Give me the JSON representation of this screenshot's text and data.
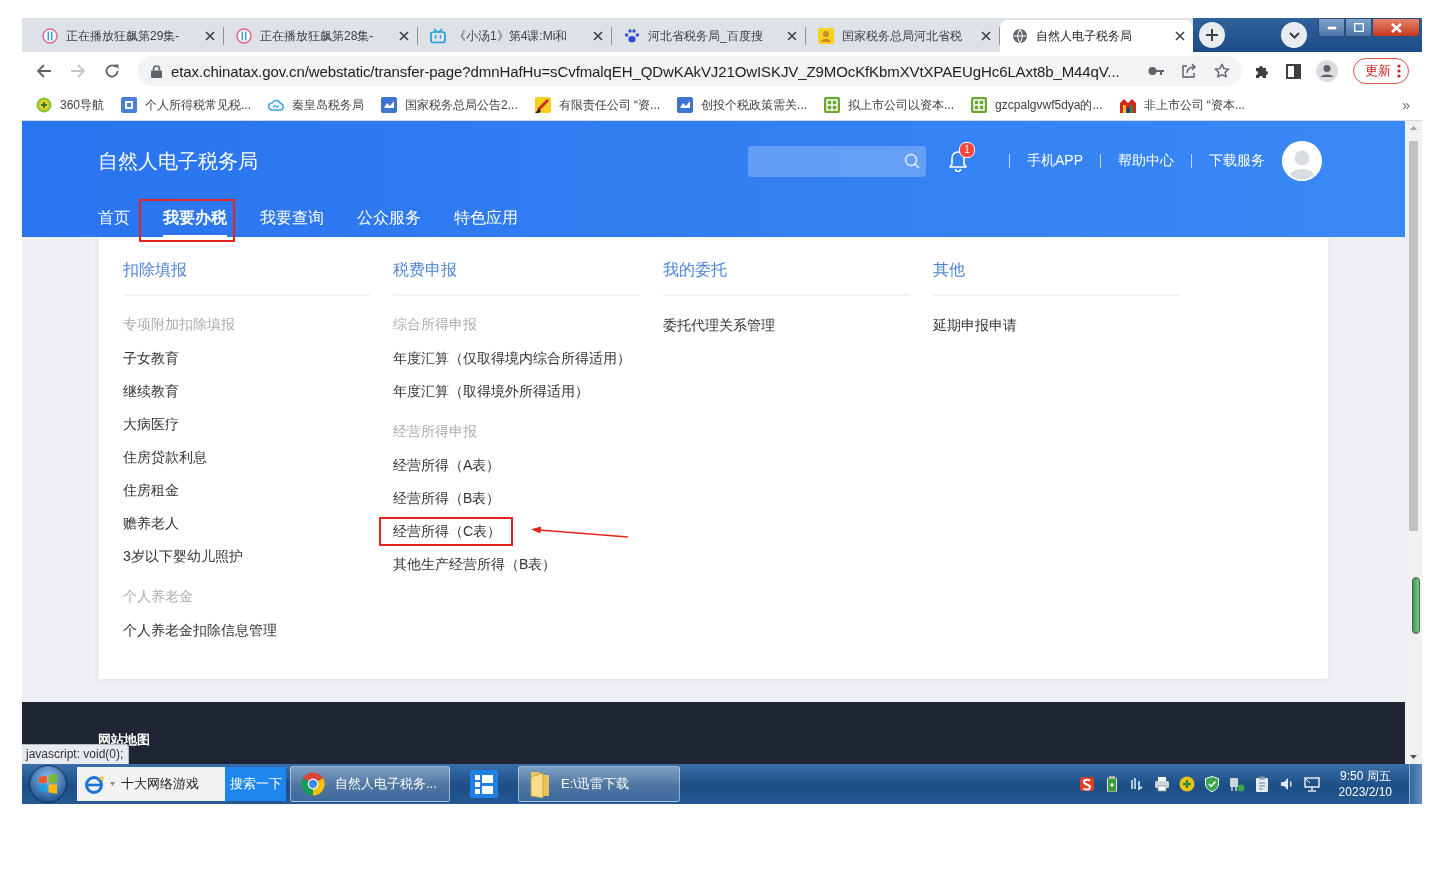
{
  "browser": {
    "tabs": [
      {
        "title": "正在播放狂飙第29集-",
        "selected": false
      },
      {
        "title": "正在播放狂飙第28集-",
        "selected": false
      },
      {
        "title": "《小汤1》第4课:Mi和",
        "selected": false
      },
      {
        "title": "河北省税务局_百度搜",
        "selected": false
      },
      {
        "title": "国家税务总局河北省税",
        "selected": false
      },
      {
        "title": "自然人电子税务局",
        "selected": true
      }
    ],
    "forward": {
      "disabled": true
    },
    "url": "etax.chinatax.gov.cn/webstatic/transfer-page?dmnHafHu=sCvfmalqEH_QDwKAkVJ21OwISKJV_Z9MOcKfKbmXVtXPAEUgHc6LAxt8b_M44qV...",
    "update_button": "更新",
    "bookmarks": [
      "360导航",
      "个人所得税常见税...",
      "秦皇岛税务局",
      "国家税务总局公告2...",
      "有限责任公司 “资...",
      "创投个税政策需关...",
      "拟上市公司以资本...",
      "gzcpalgvwf5dya的...",
      "非上市公司 “资本..."
    ],
    "bookmarks_more": "»"
  },
  "site": {
    "title": "自然人电子税务局",
    "notification_badge": "1",
    "links": [
      "手机APP",
      "帮助中心",
      "下载服务"
    ],
    "nav": [
      {
        "label": "首页",
        "selected": false,
        "marked": false
      },
      {
        "label": "我要办税",
        "selected": true,
        "marked": true
      },
      {
        "label": "我要查询",
        "selected": false,
        "marked": false
      },
      {
        "label": "公众服务",
        "selected": false,
        "marked": false
      },
      {
        "label": "特色应用",
        "selected": false,
        "marked": false
      }
    ]
  },
  "menu": {
    "columns": [
      {
        "title": "扣除填报",
        "groups": [
          {
            "heading": "专项附加扣除填报",
            "items": [
              {
                "label": "子女教育",
                "marked": false
              },
              {
                "label": "继续教育",
                "marked": false
              },
              {
                "label": "大病医疗",
                "marked": false
              },
              {
                "label": "住房贷款利息",
                "marked": false
              },
              {
                "label": "住房租金",
                "marked": false
              },
              {
                "label": "赡养老人",
                "marked": false
              },
              {
                "label": "3岁以下婴幼儿照护",
                "marked": false
              }
            ]
          },
          {
            "heading": "个人养老金",
            "items": [
              {
                "label": "个人养老金扣除信息管理",
                "marked": false
              }
            ]
          }
        ]
      },
      {
        "title": "税费申报",
        "groups": [
          {
            "heading": "综合所得申报",
            "items": [
              {
                "label": "年度汇算（仅取得境内综合所得适用）",
                "marked": false
              },
              {
                "label": "年度汇算（取得境外所得适用）",
                "marked": false
              }
            ]
          },
          {
            "heading": "经营所得申报",
            "items": [
              {
                "label": "经营所得（A表）",
                "marked": false
              },
              {
                "label": "经营所得（B表）",
                "marked": false
              },
              {
                "label": "经营所得（C表）",
                "marked": true
              },
              {
                "label": "其他生产经营所得（B表）",
                "marked": false
              }
            ]
          }
        ]
      },
      {
        "title": "我的委托",
        "groups": [
          {
            "items": [
              {
                "label": "委托代理关系管理",
                "marked": false
              }
            ]
          }
        ]
      },
      {
        "title": "其他",
        "groups": [
          {
            "items": [
              {
                "label": "延期申报申请",
                "marked": false
              }
            ]
          }
        ]
      }
    ]
  },
  "footer": {
    "link": "网站地图"
  },
  "status_bubble": "javascript: void(0);",
  "taskbar": {
    "search": {
      "value": "十大网络游戏",
      "button": "搜索一下"
    },
    "windows": [
      {
        "kind": "browser",
        "label": "自然人电子税务..."
      },
      {
        "kind": "app"
      },
      {
        "kind": "folder",
        "label": "E:\\迅雷下载"
      }
    ],
    "clock": {
      "time": "9:50 周五",
      "date": "2023/2/10"
    }
  }
}
